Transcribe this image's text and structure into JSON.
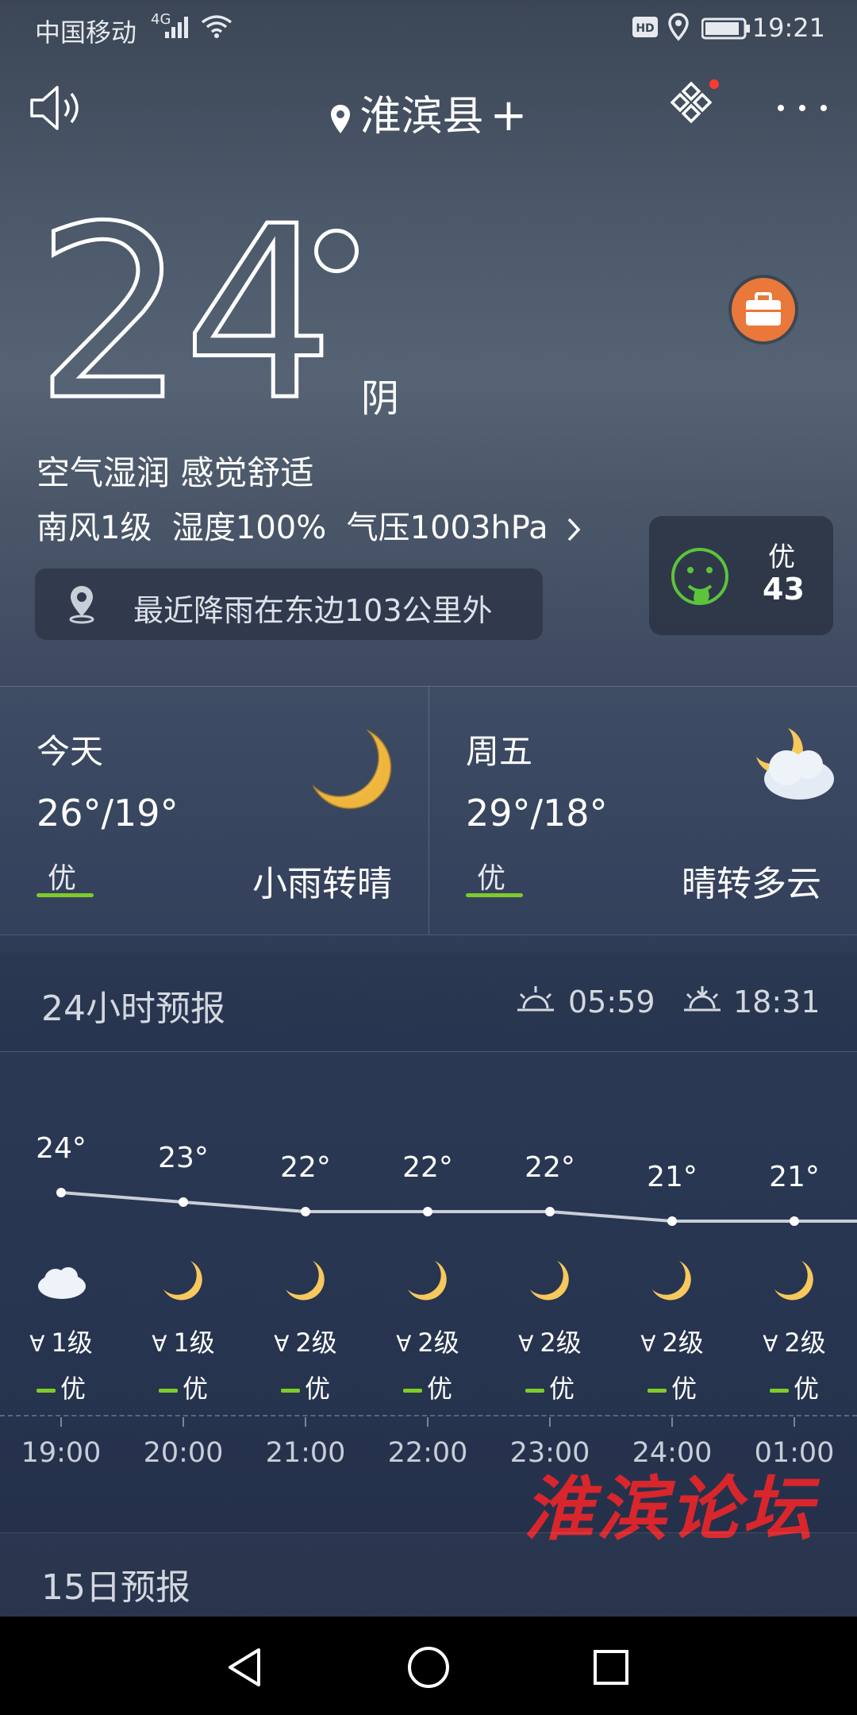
{
  "status_bar": {
    "carrier": "中国移动",
    "network": "4G",
    "time": "19:21"
  },
  "header": {
    "city": "淮滨县"
  },
  "current": {
    "temperature": "24",
    "degree": "°",
    "condition": "阴",
    "feel": "空气湿润 感觉舒适",
    "details": "南风1级  湿度100%  气压1003hPa",
    "rain_notice": "最近降雨在东边103公里外"
  },
  "aqi": {
    "level": "优",
    "value": "43"
  },
  "days": [
    {
      "name": "今天",
      "range": "26°/19°",
      "aq": "优",
      "desc": "小雨转晴"
    },
    {
      "name": "周五",
      "range": "29°/18°",
      "aq": "优",
      "desc": "晴转多云"
    }
  ],
  "hourly_header": {
    "title": "24小时预报",
    "sunrise": "05:59",
    "sunset": "18:31"
  },
  "hourly": [
    {
      "temp": "24°",
      "wind": "1级",
      "aqi": "优",
      "time": "19:00",
      "icon": "cloud-icon"
    },
    {
      "temp": "23°",
      "wind": "1级",
      "aqi": "优",
      "time": "20:00",
      "icon": "moon-icon"
    },
    {
      "temp": "22°",
      "wind": "2级",
      "aqi": "优",
      "time": "21:00",
      "icon": "moon-icon"
    },
    {
      "temp": "22°",
      "wind": "2级",
      "aqi": "优",
      "time": "22:00",
      "icon": "moon-icon"
    },
    {
      "temp": "22°",
      "wind": "2级",
      "aqi": "优",
      "time": "23:00",
      "icon": "moon-icon"
    },
    {
      "temp": "21°",
      "wind": "2级",
      "aqi": "优",
      "time": "24:00",
      "icon": "moon-icon"
    },
    {
      "temp": "21°",
      "wind": "2级",
      "aqi": "优",
      "time": "01:00",
      "icon": "moon-icon"
    }
  ],
  "watermark": "淮滨论坛",
  "day15": {
    "title": "15日预报"
  },
  "colors": {
    "aqi_green": "#7ecb2a",
    "briefcase_orange": "#e9783a",
    "moon_yellow": "#f7c85c"
  }
}
